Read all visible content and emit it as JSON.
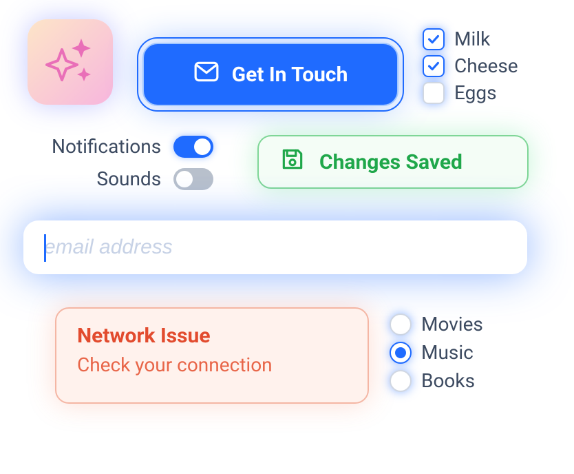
{
  "button": {
    "label": "Get In Touch"
  },
  "checkboxes": {
    "items": [
      {
        "label": "Milk",
        "checked": true
      },
      {
        "label": "Cheese",
        "checked": true
      },
      {
        "label": "Eggs",
        "checked": false
      }
    ]
  },
  "toggles": {
    "items": [
      {
        "label": "Notifications",
        "on": true
      },
      {
        "label": "Sounds",
        "on": false
      }
    ]
  },
  "saved": {
    "label": "Changes Saved"
  },
  "email": {
    "placeholder": "email address",
    "value": ""
  },
  "error": {
    "title": "Network Issue",
    "body": "Check your connection"
  },
  "radios": {
    "items": [
      {
        "label": "Movies",
        "checked": false
      },
      {
        "label": "Music",
        "checked": true
      },
      {
        "label": "Books",
        "checked": false
      }
    ]
  },
  "colors": {
    "primary": "#1f6bff",
    "success": "#1fa74a",
    "danger": "#e24b2e",
    "text": "#3c4a60"
  }
}
